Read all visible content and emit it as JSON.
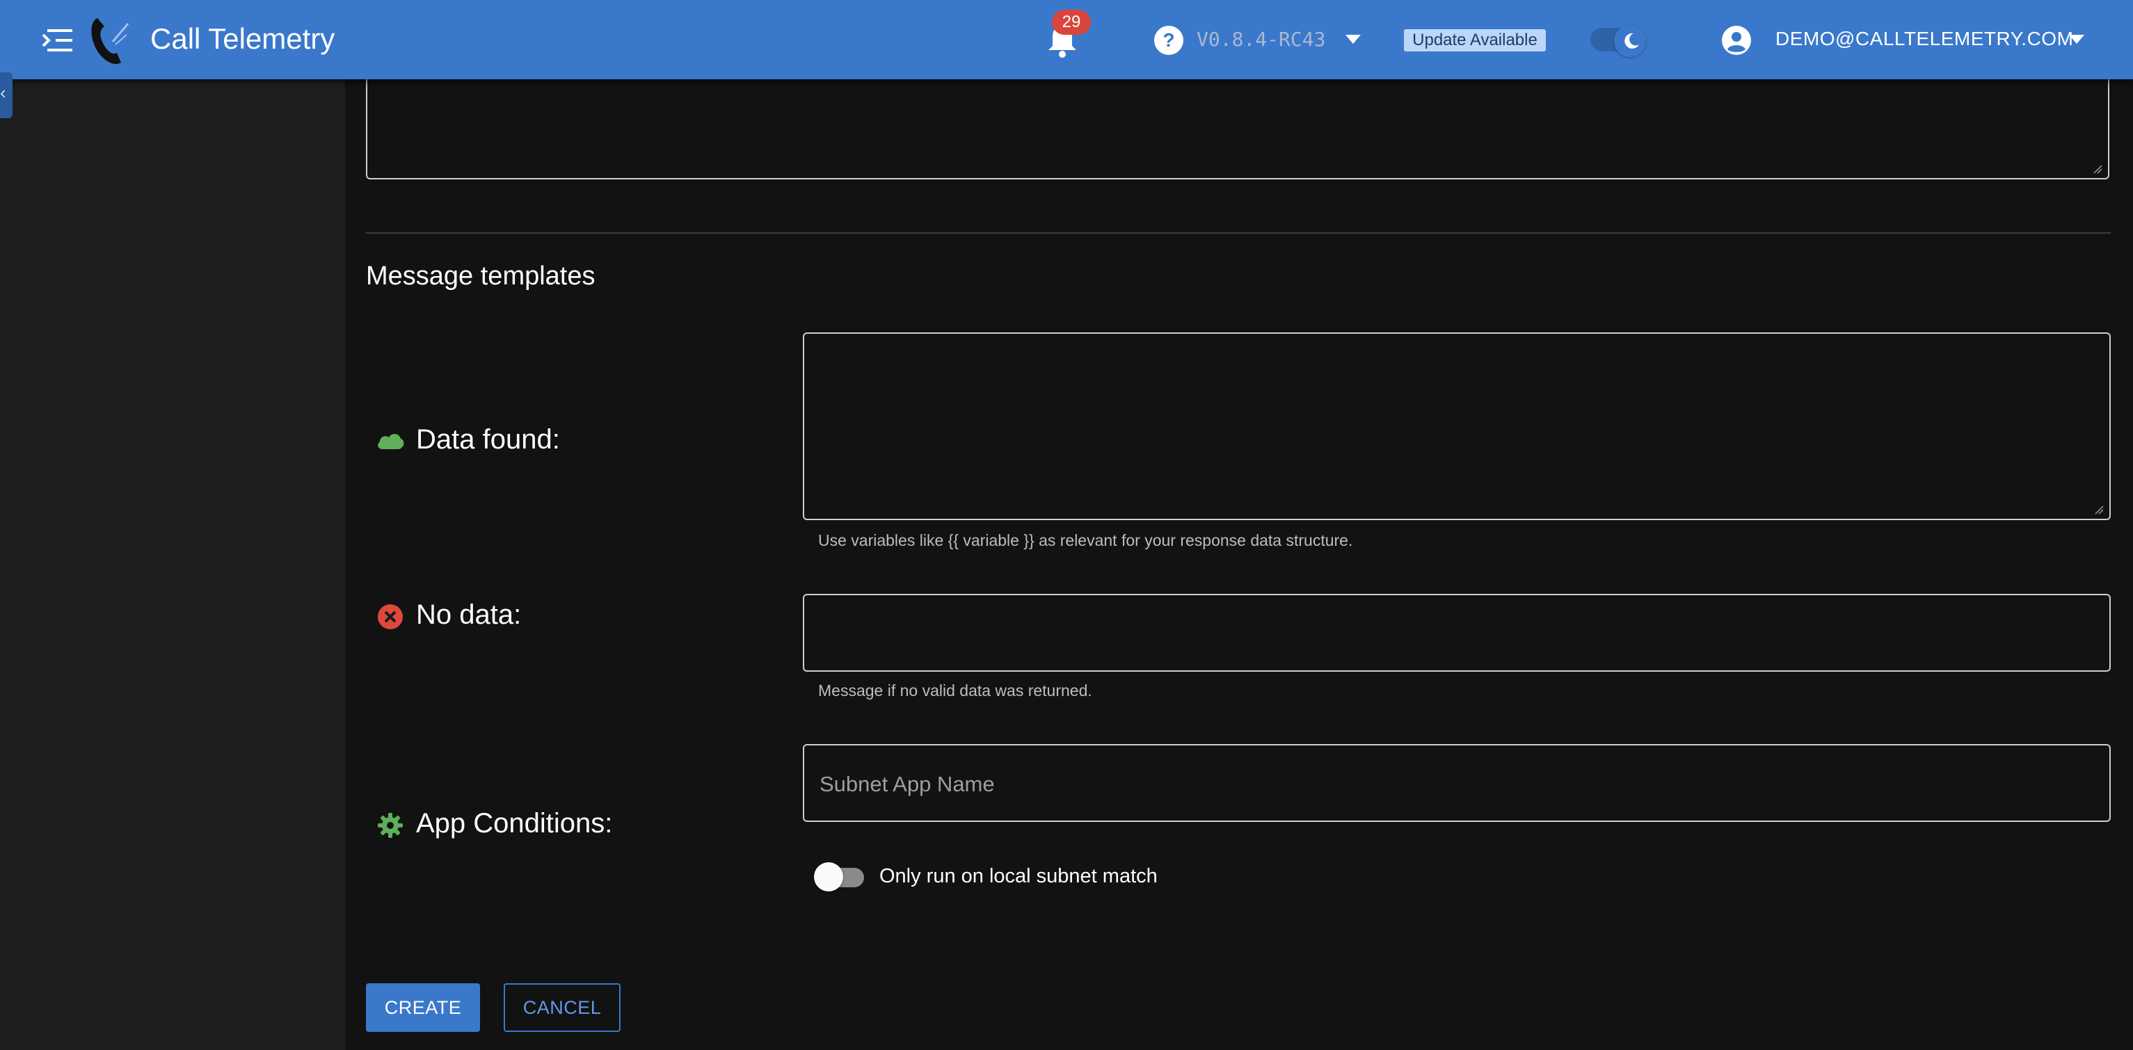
{
  "header": {
    "app_title": "Call Telemetry",
    "notification_count": "29",
    "version": "V0.8.4-RC43",
    "update_label": "Update Available",
    "user_email": "DEMO@CALLTELEMETRY.COM",
    "theme_toggle": "dark"
  },
  "main": {
    "section_title": "Message templates",
    "data_found": {
      "label": "Data found:",
      "value": "",
      "helper": "Use variables like {{ variable }} as relevant for your response data structure."
    },
    "no_data": {
      "label": "No data:",
      "value": "",
      "helper": "Message if no valid data was returned."
    },
    "app_conditions": {
      "label": "App Conditions:",
      "placeholder": "Subnet App Name",
      "switch_label": "Only run on local subnet match",
      "switch_on": false
    }
  },
  "actions": {
    "create": "CREATE",
    "cancel": "CANCEL"
  },
  "colors": {
    "primary": "#3a78cb",
    "background": "#121212",
    "sidebar": "#1e1e1e",
    "success": "#5fae5a",
    "error": "#e0483d",
    "badge": "#d9453a"
  },
  "icons": [
    "menu-icon",
    "phone-logo-icon",
    "bell-icon",
    "help-icon",
    "caret-down-icon",
    "moon-icon",
    "account-circle-icon",
    "cloud-icon",
    "close-circle-icon",
    "gear-icon"
  ]
}
